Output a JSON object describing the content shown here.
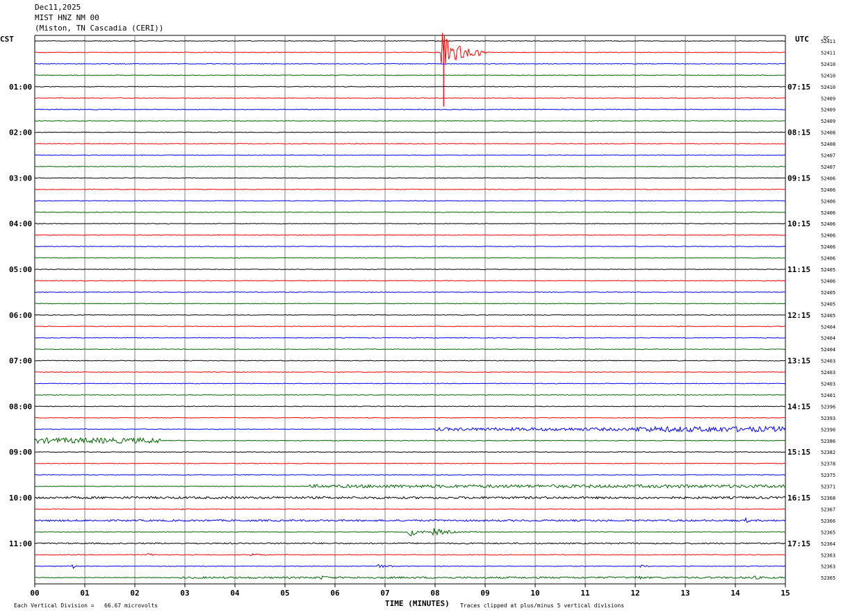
{
  "header": {
    "date": "Dec11,2025",
    "station": "MIST HNZ NM 00",
    "location": "(Miston, TN Cascadia (CERI))"
  },
  "left_timezone": "CST",
  "right_timezone": "UTC",
  "dc_label": "DC",
  "footer": {
    "scale_text": "Each Vertical Division =   66.67 microvolts",
    "axis_title": "TIME (MINUTES)",
    "clip_text": "Traces clipped at plus/minus 5 vertical divisions"
  },
  "chart_data": {
    "type": "line",
    "xlabel": "TIME (MINUTES)",
    "xlim": [
      0,
      15
    ],
    "x_ticks": [
      "00",
      "01",
      "02",
      "03",
      "04",
      "05",
      "06",
      "07",
      "08",
      "09",
      "10",
      "11",
      "12",
      "13",
      "14",
      "15"
    ],
    "trace_colors": [
      "#000000",
      "#ff0000",
      "#0000ff",
      "#006400"
    ],
    "left_hour_labels": [
      {
        "row": 4,
        "label": "01:00"
      },
      {
        "row": 8,
        "label": "02:00"
      },
      {
        "row": 12,
        "label": "03:00"
      },
      {
        "row": 16,
        "label": "04:00"
      },
      {
        "row": 20,
        "label": "05:00"
      },
      {
        "row": 24,
        "label": "06:00"
      },
      {
        "row": 28,
        "label": "07:00"
      },
      {
        "row": 32,
        "label": "08:00"
      },
      {
        "row": 36,
        "label": "09:00"
      },
      {
        "row": 40,
        "label": "10:00"
      },
      {
        "row": 44,
        "label": "11:00"
      }
    ],
    "right_hour_labels": [
      {
        "row": 4,
        "label": "07:15"
      },
      {
        "row": 8,
        "label": "08:15"
      },
      {
        "row": 12,
        "label": "09:15"
      },
      {
        "row": 16,
        "label": "10:15"
      },
      {
        "row": 20,
        "label": "11:15"
      },
      {
        "row": 24,
        "label": "12:15"
      },
      {
        "row": 28,
        "label": "13:15"
      },
      {
        "row": 32,
        "label": "14:15"
      },
      {
        "row": 36,
        "label": "15:15"
      },
      {
        "row": 40,
        "label": "16:15"
      },
      {
        "row": 44,
        "label": "17:15"
      }
    ],
    "dc_values": [
      52411,
      52411,
      52410,
      52410,
      52410,
      52409,
      52409,
      52409,
      52408,
      52408,
      52407,
      52407,
      52406,
      52406,
      52406,
      52406,
      52406,
      52406,
      52406,
      52406,
      52405,
      52406,
      52405,
      52405,
      52405,
      52404,
      52404,
      52404,
      52403,
      52403,
      52403,
      52401,
      52396,
      52393,
      52390,
      52386,
      52382,
      52378,
      52375,
      52371,
      52368,
      52367,
      52366,
      52365,
      52364,
      52363,
      52363,
      52365
    ],
    "events": [
      {
        "row": 1,
        "start_min": 8.12,
        "duration_min": 0.9,
        "amplitude_div": 5.0,
        "note": "clipped spike"
      },
      {
        "row": 34,
        "start_min": 8.0,
        "duration_min": 7.0,
        "amplitude_div": 0.35,
        "note": "sustained noise"
      },
      {
        "row": 34,
        "start_min": 9.8,
        "duration_min": 0.4,
        "amplitude_div": 0.7
      },
      {
        "row": 34,
        "start_min": 12.0,
        "duration_min": 3.0,
        "amplitude_div": 0.6
      },
      {
        "row": 34,
        "start_min": 13.6,
        "duration_min": 0.6,
        "amplitude_div": 1.0
      },
      {
        "row": 35,
        "start_min": 0.0,
        "duration_min": 2.5,
        "amplitude_div": 0.6
      },
      {
        "row": 35,
        "start_min": 1.3,
        "duration_min": 0.5,
        "amplitude_div": 0.9
      },
      {
        "row": 39,
        "start_min": 5.5,
        "duration_min": 9.5,
        "amplitude_div": 0.35
      },
      {
        "row": 40,
        "start_min": 0.0,
        "duration_min": 15.0,
        "amplitude_div": 0.25
      },
      {
        "row": 41,
        "start_min": 2.9,
        "duration_min": 0.2,
        "amplitude_div": 0.6
      },
      {
        "row": 42,
        "start_min": 0.0,
        "duration_min": 15.0,
        "amplitude_div": 0.2
      },
      {
        "row": 42,
        "start_min": 14.2,
        "duration_min": 0.3,
        "amplitude_div": 0.6
      },
      {
        "row": 43,
        "start_min": 7.45,
        "duration_min": 0.6,
        "amplitude_div": 1.3
      },
      {
        "row": 43,
        "start_min": 7.95,
        "duration_min": 1.0,
        "amplitude_div": 0.9
      },
      {
        "row": 44,
        "start_min": 0.0,
        "duration_min": 15.0,
        "amplitude_div": 0.15
      },
      {
        "row": 45,
        "start_min": 2.25,
        "duration_min": 0.3,
        "amplitude_div": 0.5
      },
      {
        "row": 45,
        "start_min": 4.3,
        "duration_min": 0.8,
        "amplitude_div": 0.4
      },
      {
        "row": 46,
        "start_min": 0.75,
        "duration_min": 0.1,
        "amplitude_div": 1.0
      },
      {
        "row": 46,
        "start_min": 6.8,
        "duration_min": 0.9,
        "amplitude_div": 0.5
      },
      {
        "row": 46,
        "start_min": 12.1,
        "duration_min": 0.8,
        "amplitude_div": 0.3
      },
      {
        "row": 47,
        "start_min": 2.9,
        "duration_min": 12.1,
        "amplitude_div": 0.2
      },
      {
        "row": 47,
        "start_min": 5.7,
        "duration_min": 0.7,
        "amplitude_div": 0.5
      },
      {
        "row": 47,
        "start_min": 12.0,
        "duration_min": 0.8,
        "amplitude_div": 0.5
      },
      {
        "row": 47,
        "start_min": 14.3,
        "duration_min": 0.7,
        "amplitude_div": 0.6
      }
    ]
  }
}
